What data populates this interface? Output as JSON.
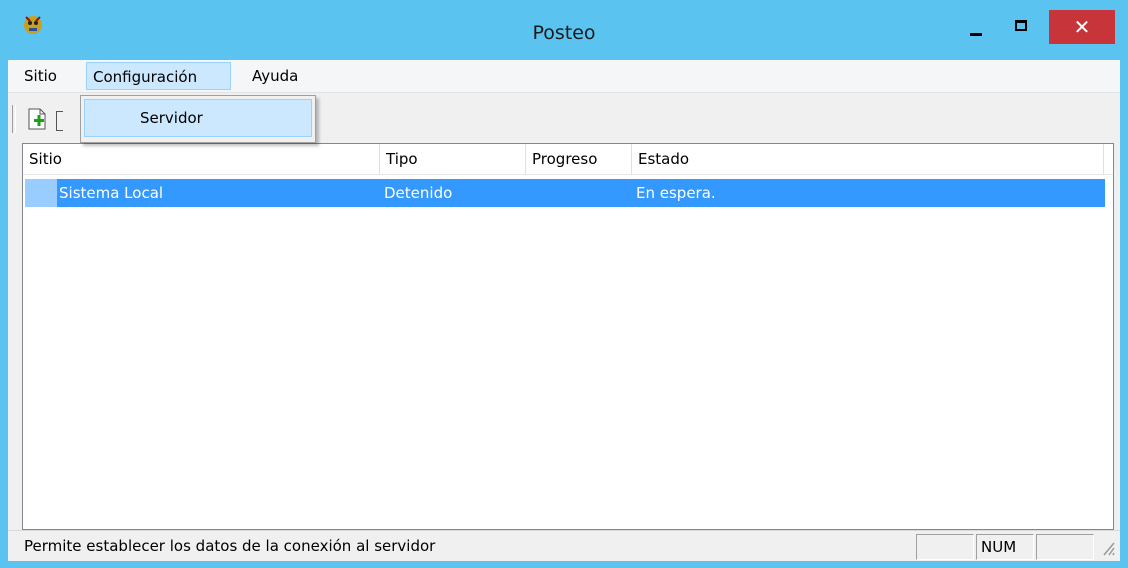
{
  "window": {
    "title": "Posteo"
  },
  "titlebar": {
    "close_glyph": "✕"
  },
  "menu": {
    "sitio": "Sitio",
    "configuracion": "Configuración",
    "ayuda": "Ayuda"
  },
  "dropdown": {
    "servidor": "Servidor"
  },
  "list": {
    "columns": [
      "Sitio",
      "Tipo",
      "Progreso",
      "Estado"
    ],
    "rows": [
      {
        "sitio": "Sistema Local",
        "tipo": "Detenido",
        "progreso": "",
        "estado": "En espera."
      }
    ]
  },
  "statusbar": {
    "message": "Permite establecer los datos de la conexión al servidor",
    "pane1": "",
    "pane2": "NUM",
    "pane3": ""
  },
  "colors": {
    "titlebar": "#5ac3ef",
    "selection": "#3399ff",
    "close": "#c7343a"
  }
}
